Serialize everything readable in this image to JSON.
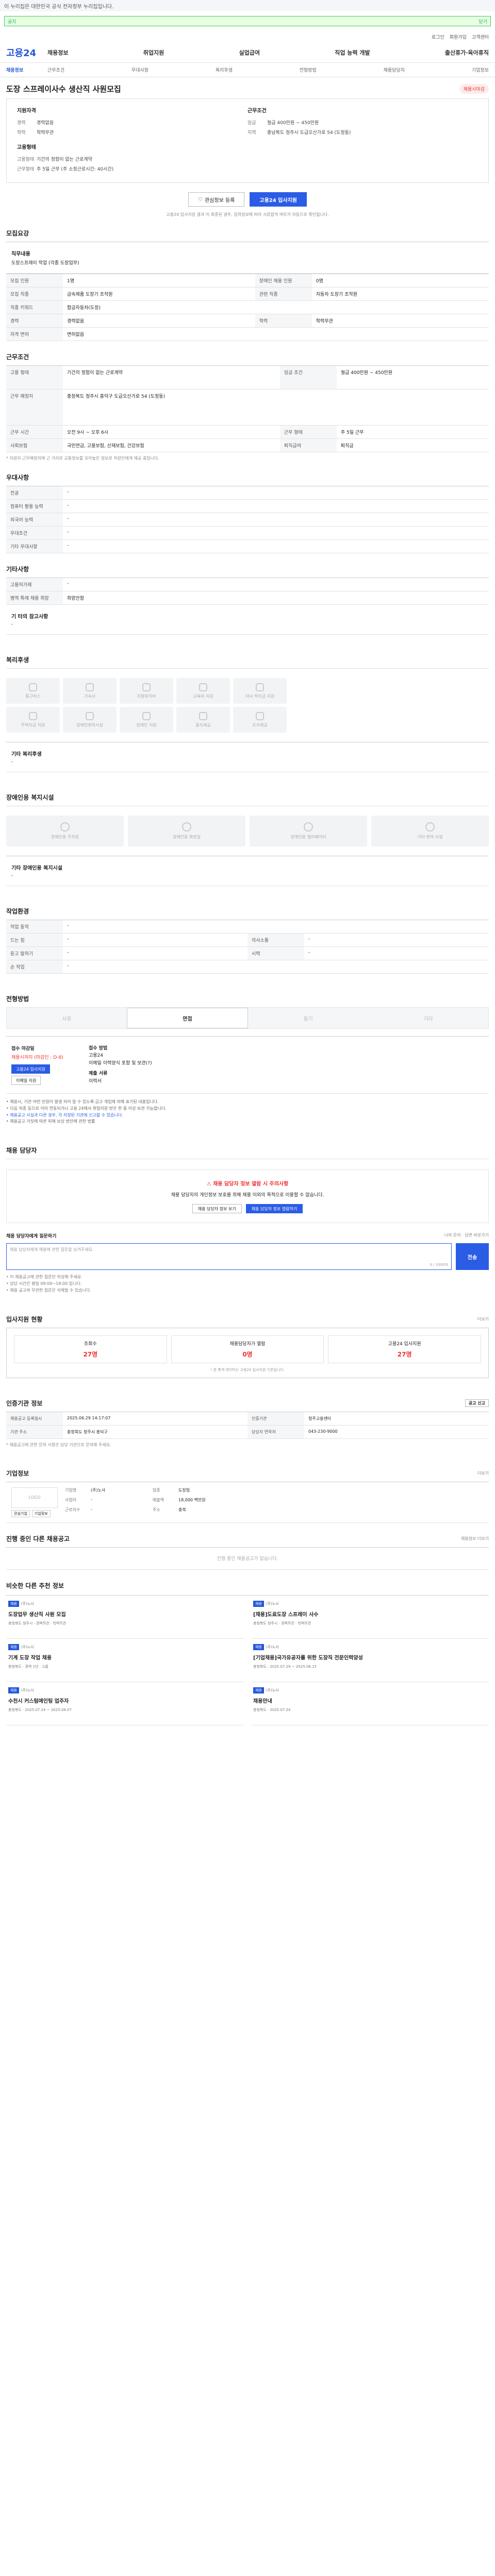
{
  "topbar": "이 누리집은 대한민국 공식 전자정부 누리집입니다.",
  "notice": {
    "label": "공지",
    "close": "닫기"
  },
  "util": [
    "로그인",
    "회원가입",
    "고객센터"
  ],
  "logo": "고용24",
  "gnb": [
    "채용정보",
    "취업지원",
    "실업급여",
    "직업 능력 개발",
    "출산휴가·육아휴직"
  ],
  "lnb": {
    "cat": "채용정보",
    "items": [
      "근무조건",
      "우대사항",
      "복리후생",
      "전형방법",
      "채용담당자",
      "기업정보"
    ]
  },
  "job": {
    "title": "도장 스프레이사수 생산직 사원모집",
    "status": "채용시마감",
    "left_title": "지원자격",
    "left": [
      {
        "k": "경력",
        "v": "경력없음"
      },
      {
        "k": "학력",
        "v": "학력무관"
      }
    ],
    "left2_title": "고용형태",
    "left2": [
      {
        "k": "고용형태",
        "v": "기간의 정함이 없는 근로계약"
      },
      {
        "k": "근무형태",
        "v": "주 5일 근무 (주 소정근로시간: 40시간)"
      }
    ],
    "right_title": "근무조건",
    "right": [
      {
        "k": "임금",
        "v": "월급 400만원 ~ 450만원"
      },
      {
        "k": "지역",
        "v": "충남북도 청주시 도급오산가로 54 (도정동)"
      }
    ],
    "btn_interest": "관심정보 등록",
    "btn_apply": "고용24 입사지원",
    "warn": "고용24 입사지원 결과 이 최종된 경우, 입력정보에 따라 서류합격 여부가 자동으로 확인됩니다."
  },
  "recruit": {
    "title": "모집요강",
    "desc_label": "직무내용",
    "desc": "도장스프레이 작업 (각종 도장업무)",
    "rows": [
      [
        "모집 인원",
        "1명",
        "장애인 채용 인원",
        "0명"
      ],
      [
        "모집 직종",
        "금속제품 도장기 조작원",
        "관련 직종",
        "자동차 도장기 조작원"
      ],
      [
        "직종 키워드",
        "합금자동차(도장)",
        "",
        ""
      ],
      [
        "경력",
        "경력없음",
        "학력",
        "학력무관"
      ],
      [
        "자격 면허",
        "면허없음",
        "",
        ""
      ]
    ]
  },
  "work": {
    "title": "근무조건",
    "rows": [
      [
        "고용 형태",
        "기간의 정함이 없는 근로계약",
        "임금 조건",
        "월급 400만원 ~ 450만원"
      ],
      [
        "근무 예정지",
        "충청북도 청주시 흥덕구 도급오산가로 54 (도정동)",
        "",
        ""
      ],
      [
        "근무 시간",
        "오전 9시 ~ 오후 6시",
        "근무 형태",
        "주 5일 근무"
      ],
      [
        "사회보험",
        "국민연금, 고용보험, 산재보험, 건강보험",
        "퇴직급여",
        "퇴직금"
      ]
    ],
    "note": "* 지원자 근무예정지에 근 거리로 교통정보를 모아놓은 정보로 직장인에게 제공 중입니다."
  },
  "pref": {
    "title": "우대사항",
    "rows": [
      [
        "전공",
        "-"
      ],
      [
        "컴퓨터 활용 능력",
        "-"
      ],
      [
        "외국어 능력",
        "-"
      ],
      [
        "우대조건",
        "-"
      ],
      [
        "기타 우대사항",
        "-"
      ]
    ]
  },
  "etc": {
    "title": "기타사항",
    "rows": [
      [
        "고용허가제",
        "-"
      ],
      [
        "병역 특례 채용 희망",
        "희망안함"
      ]
    ],
    "extra_label": "기 타의 참고사항",
    "extra": "-"
  },
  "welfare": {
    "title": "복리후생",
    "items": [
      "통근버스",
      "기숙사",
      "차량유지비",
      "교육비 지원",
      "자녀 학자금 지원",
      "주택자금 지원",
      "장애인편의시설",
      "장애인 지원",
      "중식제공",
      "조식제공"
    ],
    "other_label": "기타 복리후생",
    "other": "-"
  },
  "disability": {
    "title": "장애인용 복지시설",
    "items": [
      "장애인용 주차장",
      "장애인용 화장실",
      "장애인용 엘리베이터",
      "기타 편의 시설"
    ],
    "other_label": "기타 장애인용 복지시설",
    "other": "-"
  },
  "env": {
    "title": "작업환경",
    "rows": [
      [
        "작업 동작",
        "-",
        "",
        ""
      ],
      [
        "드는 힘",
        "-",
        "의사소통",
        "-"
      ],
      [
        "듣고 말하기",
        "-",
        "시력",
        "-"
      ],
      [
        "손 작업",
        "-",
        "",
        ""
      ]
    ]
  },
  "process": {
    "title": "전형방법",
    "tabs": [
      "서류",
      "면접",
      "필기",
      "기타"
    ],
    "active": 1,
    "l1": "접수 마감일",
    "l2": "채용시까지 (마감인 : D-8)",
    "l3": "고용24 입사지원",
    "l4": "이메일 지원",
    "r1": "접수 방법",
    "r2": "고용24",
    "r3": "이메일 이력양식 포함 및 보관(?)",
    "r4": "제출 서류",
    "r5": "이력서"
  },
  "notes": [
    "• 채용시, 기관 어떤 민원이 발생 되어 알 수 있도록 금고 개입에 의해 표기된 내용입니다.",
    "• 다음 직종 등으로 이미 연동되거나 고용 24에서 취업지원 받은 한 중 이상 보관 가능합니다.",
    "• 채용공고 사실과 다른 경우, 각 지정된 기관에 신고할 수 있습니다.",
    "• 채용공고 거짓에 따른 피해 보상 방안에 관한 법률"
  ],
  "talk": {
    "title": "채용 담당자",
    "warn": "채용 담당자 정보 열람 시 주의사항",
    "desc": "채용 담당자의 개인정보 보호를 위해 채용 이외의 목적으로 이용할 수 없습니다.",
    "btn1": "채용 담당자 정보 보기",
    "btn2": "채용 담당자 정보 열람하기"
  },
  "inquiry": {
    "label": "채용 담당자에게 질문하기",
    "link": "나의 문의 · 답변 바로가기",
    "placeholder": "채용 담당자에게 채용에 관한 질문을 남겨주세요.",
    "count": "0 / 1000자",
    "send": "전송",
    "notes": [
      "• 이 채용공고에 관한 질문만 작성해 주세요.",
      "• 상담 시간은 평일 09:00~18:00 입니다.",
      "• 채용 공고와 무관한 질문은 삭제될 수 있습니다."
    ]
  },
  "stats": {
    "title": "입사지원 현황",
    "more": "더보기",
    "items": [
      {
        "k": "조회수",
        "v": "27명"
      },
      {
        "k": "채용담당자가 열람",
        "v": "0명"
      },
      {
        "k": "고용24 입사지원",
        "v": "27명"
      }
    ],
    "note": "* 본 통계 데이터는 고용24 입사지원 기준입니다."
  },
  "info": {
    "title": "인증기관 정보",
    "btn": "공고 신고",
    "cells": [
      [
        "채용공고 등록일시",
        "2025.06.29 14:17:07",
        "인증기관",
        "청주고용센터"
      ],
      [
        "기관 주소",
        "충청북도 청주시 흥덕구",
        "담당자 연락처",
        "043-230-9000"
      ]
    ],
    "note": "* 채용공고에 관한 문의 사항은 담당 기관으로 문의해 주세요."
  },
  "company": {
    "title": "기업정보",
    "more": "더보기",
    "logo": "LOGO",
    "btns": [
      "관심기업",
      "기업정보"
    ],
    "rows": [
      [
        "기업명",
        "(주)노사",
        "업종",
        "도장업"
      ],
      [
        "사업자",
        "-",
        "매출액",
        "18,000 백만원"
      ],
      [
        "근로자수",
        "-",
        "주소",
        "충북"
      ]
    ]
  },
  "ongoing": {
    "title": "진행 중인 다른 채용공고",
    "link": "채용정보 더보기",
    "empty": "진행 중인 채용공고가 없습니다."
  },
  "recent": {
    "title": "비슷한 다른 추천 정보",
    "items": [
      {
        "tag": "채용",
        "co": "(주)노사",
        "ttl": "도장업무 생산직 사원 모집",
        "meta": "충청북도 청주시 · 경력무관 · 학력무관"
      },
      {
        "tag": "채용",
        "co": "(주)노사",
        "ttl": "[채용]도료도장 스프레이 사수",
        "meta": "충청북도 청주시 · 경력무관 · 학력무관"
      },
      {
        "tag": "채용",
        "co": "(주)노사",
        "ttl": "기계 도장 작업 채용",
        "meta": "충청북도 · 경력 2년 · 고졸"
      },
      {
        "tag": "채용",
        "co": "(주)노사",
        "ttl": "[기업채용]국가유공자를 위한 도장직 전문인력양성",
        "meta": "충청북도 · 2025.07.29 ~ 2025.08.15"
      },
      {
        "tag": "채용",
        "co": "(주)노사",
        "ttl": "수천시 커스텀에인팅 업주자",
        "meta": "충청북도 · 2025.07.24 ~ 2025.08.07"
      },
      {
        "tag": "채용",
        "co": "(주)노사",
        "ttl": "채용안내",
        "meta": "충청북도 · 2025.07.24"
      }
    ]
  }
}
